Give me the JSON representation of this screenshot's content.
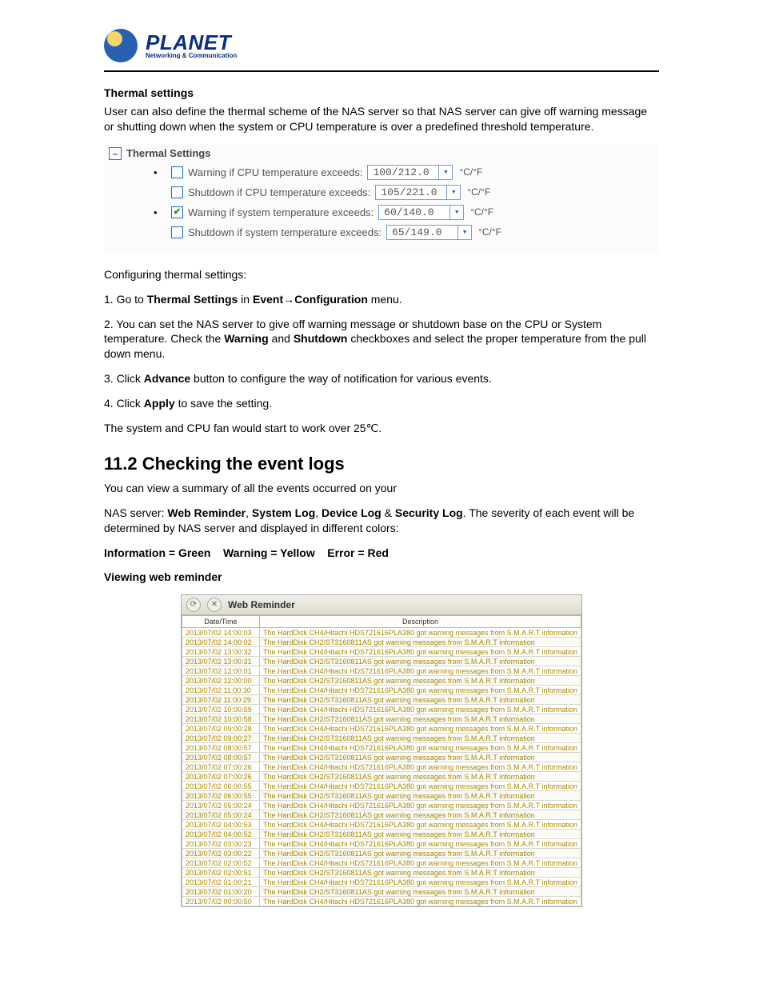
{
  "logo": {
    "brand": "PLANET",
    "tagline": "Networking & Communication"
  },
  "thermal": {
    "heading": "Thermal settings",
    "intro": "User can also define the thermal scheme of the NAS server so that NAS server can give off warning message or shutting down when the system or CPU temperature is over a predefined threshold temperature.",
    "panel_title": "Thermal Settings",
    "rows": [
      {
        "bullet": true,
        "checked": false,
        "label": "Warning if CPU temperature exceeds:",
        "value": "100/212.0",
        "unit": "°C/°F"
      },
      {
        "bullet": false,
        "checked": false,
        "label": "Shutdown if CPU temperature exceeds:",
        "value": "105/221.0",
        "unit": "°C/°F"
      },
      {
        "bullet": true,
        "checked": true,
        "label": "Warning if system temperature exceeds:",
        "value": "60/140.0",
        "unit": "°C/°F"
      },
      {
        "bullet": false,
        "checked": false,
        "label": "Shutdown if system temperature exceeds:",
        "value": "65/149.0",
        "unit": "°C/°F"
      }
    ],
    "config_lead": "Configuring thermal settings:",
    "steps": {
      "s1a": "1. Go to ",
      "s1b": "Thermal Settings",
      "s1c": " in ",
      "s1d": "Event",
      "s1e": "→",
      "s1f": "Configuration",
      "s1g": " menu.",
      "s2a": "2. You can set the NAS server to give off warning message or shutdown base on the CPU or System temperature. Check the ",
      "s2b": "Warning",
      "s2c": " and ",
      "s2d": "Shutdown",
      "s2e": " checkboxes and select the proper temperature from the pull down menu.",
      "s3a": "3. Click ",
      "s3b": "Advance",
      "s3c": " button to configure the way of notification for various events.",
      "s4a": "4. Click ",
      "s4b": "Apply",
      "s4c": " to save the setting."
    },
    "note": "The system and CPU fan would start to work over 25℃."
  },
  "events": {
    "heading": "11.2 Checking the event logs",
    "line1": "You can view a summary of all the events occurred on your",
    "line2a": "NAS server: ",
    "line2_terms": [
      "Web Reminder",
      "System Log",
      "Device Log",
      "Security Log"
    ],
    "line2_seps": [
      ", ",
      ", ",
      " & "
    ],
    "line2b": ". The severity of each event will be determined by NAS server and displayed in different colors:",
    "legend": "Information = Green    Warning = Yellow    Error = Red",
    "viewing": "Viewing web reminder"
  },
  "webrem": {
    "title": "Web Reminder",
    "cols": [
      "Date/Time",
      "Description"
    ],
    "desc_ch4": "The HardDisk CH4/Hitachi HDS721616PLA380 got warning messages from S.M.A.R.T information",
    "desc_ch2": "The HardDisk CH2/ST3160811AS got warning messages from S.M.A.R.T information",
    "rows": [
      {
        "dt": "2013/07/02 14:00:03",
        "k": "ch4"
      },
      {
        "dt": "2013/07/02 14:00:02",
        "k": "ch2"
      },
      {
        "dt": "2013/07/02 13:00:32",
        "k": "ch4"
      },
      {
        "dt": "2013/07/02 13:00:31",
        "k": "ch2"
      },
      {
        "dt": "2013/07/02 12:00:01",
        "k": "ch4"
      },
      {
        "dt": "2013/07/02 12:00:00",
        "k": "ch2"
      },
      {
        "dt": "2013/07/02 11:00:30",
        "k": "ch4"
      },
      {
        "dt": "2013/07/02 11:00:29",
        "k": "ch2"
      },
      {
        "dt": "2013/07/02 10:00:59",
        "k": "ch4"
      },
      {
        "dt": "2013/07/02 10:00:58",
        "k": "ch2"
      },
      {
        "dt": "2013/07/02 09:00:28",
        "k": "ch4"
      },
      {
        "dt": "2013/07/02 09:00:27",
        "k": "ch2"
      },
      {
        "dt": "2013/07/02 08:00:57",
        "k": "ch4"
      },
      {
        "dt": "2013/07/02 08:00:57",
        "k": "ch2"
      },
      {
        "dt": "2013/07/02 07:00:26",
        "k": "ch4"
      },
      {
        "dt": "2013/07/02 07:00:26",
        "k": "ch2"
      },
      {
        "dt": "2013/07/02 06:00:55",
        "k": "ch4"
      },
      {
        "dt": "2013/07/02 06:00:55",
        "k": "ch2"
      },
      {
        "dt": "2013/07/02 05:00:24",
        "k": "ch4"
      },
      {
        "dt": "2013/07/02 05:00:24",
        "k": "ch2"
      },
      {
        "dt": "2013/07/02 04:00:53",
        "k": "ch4"
      },
      {
        "dt": "2013/07/02 04:00:52",
        "k": "ch2"
      },
      {
        "dt": "2013/07/02 03:00:23",
        "k": "ch4"
      },
      {
        "dt": "2013/07/02 03:00:22",
        "k": "ch2"
      },
      {
        "dt": "2013/07/02 02:00:52",
        "k": "ch4"
      },
      {
        "dt": "2013/07/02 02:00:51",
        "k": "ch2"
      },
      {
        "dt": "2013/07/02 01:00:21",
        "k": "ch4"
      },
      {
        "dt": "2013/07/02 01:00:20",
        "k": "ch2"
      },
      {
        "dt": "2013/07/02 00:00:50",
        "k": "ch4"
      }
    ]
  }
}
